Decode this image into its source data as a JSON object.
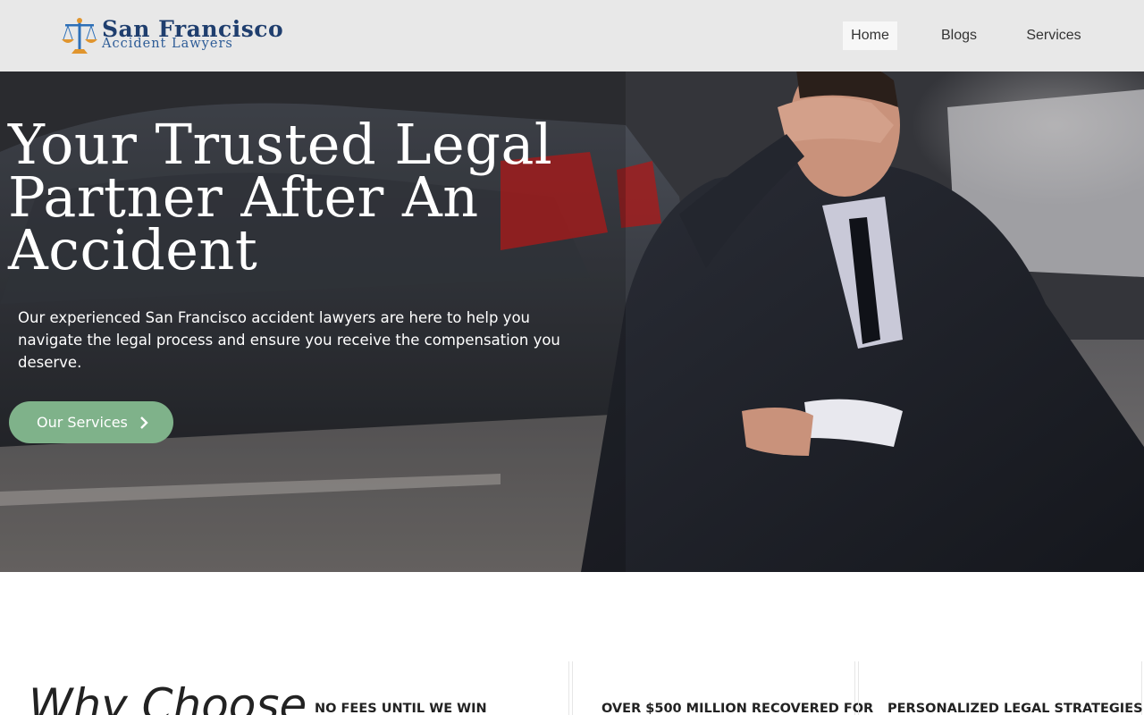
{
  "header": {
    "logo": {
      "line1": "San Francisco",
      "line2": "Accident Lawyers"
    },
    "nav": [
      {
        "label": "Home"
      },
      {
        "label": "Blogs"
      },
      {
        "label": "Services"
      }
    ]
  },
  "hero": {
    "title": "Your Trusted Legal Partner After An Accident",
    "subtitle": "Our experienced San Francisco accident lawyers are here to help you navigate the legal process and ensure you receive the compensation you deserve.",
    "button_label": "Our Services"
  },
  "why": {
    "title": "Why Choose",
    "features": [
      {
        "title": "NO FEES UNTIL WE WIN"
      },
      {
        "title": "OVER $500 MILLION RECOVERED FOR"
      },
      {
        "title": "PERSONALIZED LEGAL STRATEGIES"
      }
    ]
  },
  "colors": {
    "header_bg": "#e8e8e8",
    "button_bg": "#7fb28a",
    "logo_navy": "#1f3e6e"
  },
  "icons": [
    "scales-of-justice-icon",
    "chevron-right-icon"
  ]
}
